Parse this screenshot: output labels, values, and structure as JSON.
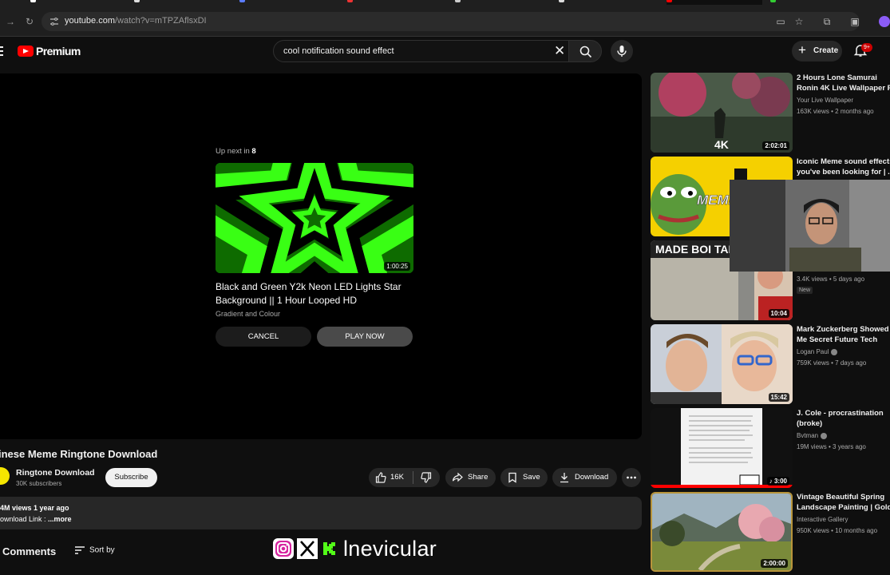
{
  "browser": {
    "url_host": "youtube.com",
    "url_path": "/watch?v=mTPZAflsxDI"
  },
  "masthead": {
    "logo_text": "Premium",
    "search_value": "cool notification sound effect",
    "create_label": "Create",
    "notification_count": "9+"
  },
  "up_next": {
    "label": "Up next in",
    "countdown": "8",
    "duration": "1:00:25",
    "title": "Black and Green Y2k Neon LED Lights Star Background || 1 Hour Looped HD",
    "channel": "Gradient and Colour",
    "cancel_label": "CANCEL",
    "play_label": "PLAY NOW"
  },
  "video": {
    "title": "inese Meme Ringtone Download",
    "channel": "Ringtone Download",
    "subscribers": "30K subscribers",
    "subscribe_label": "Subscribe",
    "likes": "16K",
    "share_label": "Share",
    "save_label": "Save",
    "download_label": "Download",
    "views_date": "4M views  1 year ago",
    "description": "ownload Link : ",
    "more_label": "...more",
    "comments_label": "Comments",
    "sort_label": "Sort by"
  },
  "watermark": {
    "handle": "lnevicular"
  },
  "recommendations": [
    {
      "title": "2 Hours Lone Samurai Ronin 4K Live Wallpaper For PC ...",
      "channel": "Your Live Wallpaper",
      "meta": "163K views • 2 months ago",
      "duration": "2:02:01",
      "overlay": "4K"
    },
    {
      "title": "Iconic Meme sound effects you've been looking for | ...",
      "channel": "",
      "meta": "",
      "duration": "",
      "overlay": "MEME EFF"
    },
    {
      "title": "",
      "channel": "",
      "meta": "3.4K views • 5 days ago",
      "badge": "New",
      "duration": "10:04",
      "overlay": "MADE BOI TAKI 183"
    },
    {
      "title": "Mark Zuckerberg Showed Me Secret Future Tech",
      "channel": "Logan Paul",
      "meta": "759K views • 7 days ago",
      "duration": "15:42"
    },
    {
      "title": "J. Cole - procrastination (broke)",
      "channel": "Bvtman",
      "meta": "19M views • 3 years ago",
      "duration": "3:00"
    },
    {
      "title": "Vintage Beautiful Spring Landscape Painting | Gold ...",
      "channel": "Interactive Gallery",
      "meta": "950K views • 10 months ago",
      "duration": "2:00:00"
    }
  ],
  "colors": {
    "brand_red": "#ff0000",
    "background": "#0f0f0f",
    "neon_green": "#39ff14"
  }
}
